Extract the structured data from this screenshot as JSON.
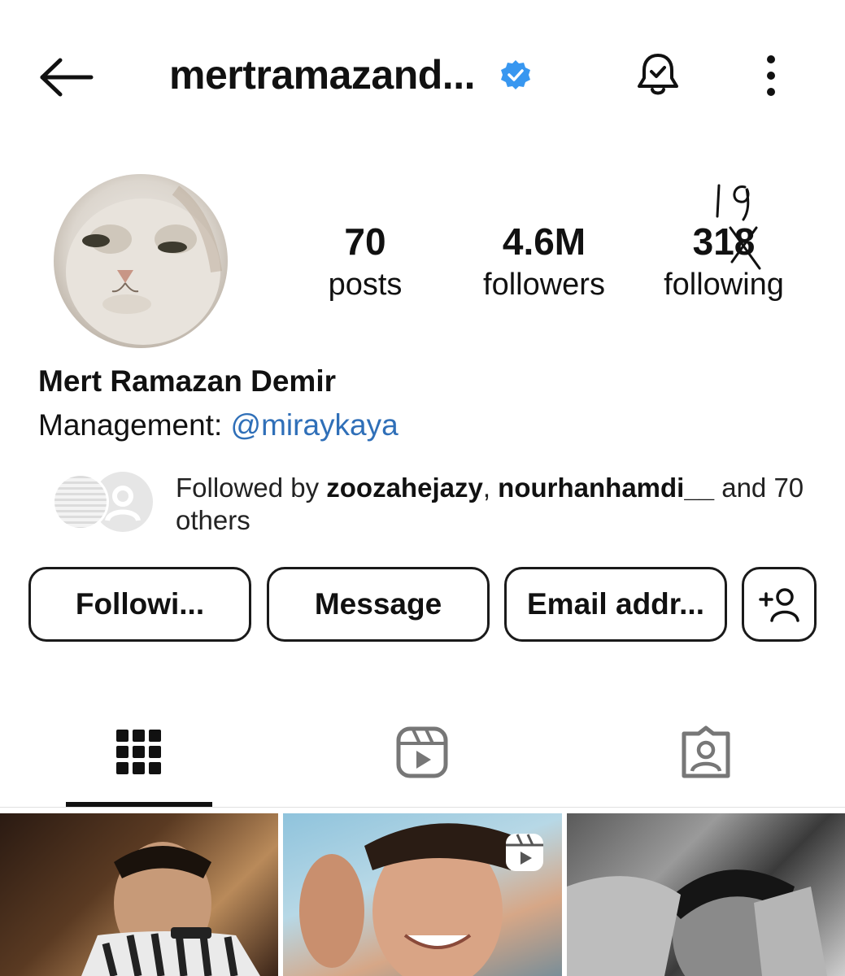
{
  "header": {
    "back_icon": "arrow-left-icon",
    "username": "mertramazand...",
    "verified_icon": "verified-badge-icon",
    "verified_color": "#3897f0",
    "notifications_icon": "bell-check-icon",
    "more_icon": "more-vertical-icon"
  },
  "profile": {
    "avatar_icon": "cat-avatar",
    "stats": [
      {
        "value": "70",
        "label": "posts"
      },
      {
        "value": "4.6M",
        "label": "followers"
      },
      {
        "value": "318",
        "label": "following"
      }
    ],
    "handwritten_annotation": "19"
  },
  "bio": {
    "name": "Mert Ramazan Demir",
    "management_prefix": "Management: ",
    "management_link": "@miraykaya",
    "link_color": "#2f6fb8"
  },
  "mutual": {
    "prefix": "Followed by ",
    "user1": "zoozahejazy",
    "separator": ", ",
    "user2": "nourhanhamdi__",
    "suffix": " and 70 others"
  },
  "actions": {
    "following_label": "Followi...",
    "message_label": "Message",
    "email_label": "Email addr...",
    "add_user_icon": "add-person-icon"
  },
  "tabs": [
    {
      "icon": "grid-icon",
      "active": true
    },
    {
      "icon": "reels-icon",
      "active": false
    },
    {
      "icon": "tagged-icon",
      "active": false
    }
  ],
  "posts": [
    {
      "type": "photo"
    },
    {
      "type": "reel",
      "badge_icon": "reel-icon"
    },
    {
      "type": "photo"
    }
  ]
}
